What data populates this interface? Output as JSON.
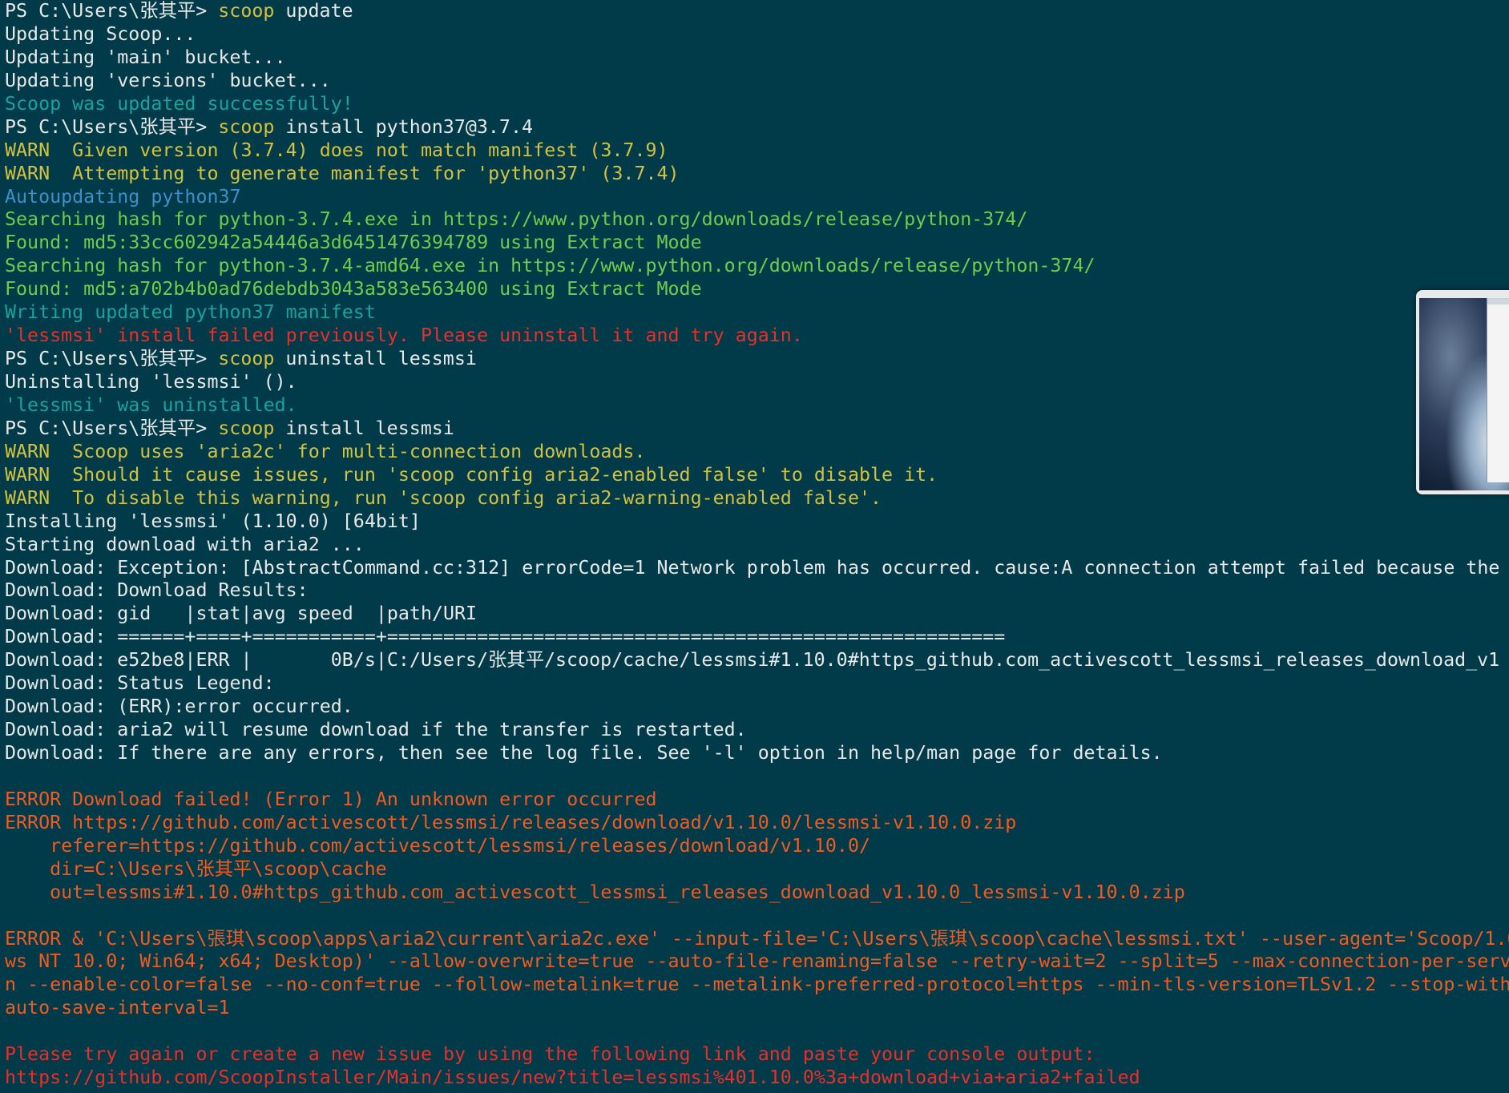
{
  "terminal": {
    "lines": [
      {
        "segments": [
          {
            "text": "PS C:\\Users\\张其平> ",
            "color": "white"
          },
          {
            "text": "scoop",
            "color": "yellow"
          },
          {
            "text": " update",
            "color": "white"
          }
        ]
      },
      {
        "segments": [
          {
            "text": "Updating Scoop...",
            "color": "white"
          }
        ]
      },
      {
        "segments": [
          {
            "text": "Updating 'main' bucket...",
            "color": "white"
          }
        ]
      },
      {
        "segments": [
          {
            "text": "Updating 'versions' bucket...",
            "color": "white"
          }
        ]
      },
      {
        "segments": [
          {
            "text": "Scoop was updated successfully!",
            "color": "cyan"
          }
        ]
      },
      {
        "segments": [
          {
            "text": "PS C:\\Users\\张其平> ",
            "color": "white"
          },
          {
            "text": "scoop",
            "color": "yellow"
          },
          {
            "text": " install python37@3.7.4",
            "color": "white"
          }
        ]
      },
      {
        "segments": [
          {
            "text": "WARN  Given version (3.7.4) does not match manifest (3.7.9)",
            "color": "yellow"
          }
        ]
      },
      {
        "segments": [
          {
            "text": "WARN  Attempting to generate manifest for 'python37' (3.7.4)",
            "color": "yellow"
          }
        ]
      },
      {
        "segments": [
          {
            "text": "Autoupdating python37",
            "color": "blue"
          }
        ]
      },
      {
        "segments": [
          {
            "text": "Searching hash for python-3.7.4.exe in https://www.python.org/downloads/release/python-374/",
            "color": "green"
          }
        ]
      },
      {
        "segments": [
          {
            "text": "Found: md5:33cc602942a54446a3d6451476394789 using Extract Mode",
            "color": "green"
          }
        ]
      },
      {
        "segments": [
          {
            "text": "Searching hash for python-3.7.4-amd64.exe in https://www.python.org/downloads/release/python-374/",
            "color": "green"
          }
        ]
      },
      {
        "segments": [
          {
            "text": "Found: md5:a702b4b0ad76debdb3043a583e563400 using Extract Mode",
            "color": "green"
          }
        ]
      },
      {
        "segments": [
          {
            "text": "Writing updated python37 manifest",
            "color": "cyan"
          }
        ]
      },
      {
        "segments": [
          {
            "text": "'lessmsi' install failed previously. Please uninstall it and try again.",
            "color": "red"
          }
        ]
      },
      {
        "segments": [
          {
            "text": "PS C:\\Users\\张其平> ",
            "color": "white"
          },
          {
            "text": "scoop",
            "color": "yellow"
          },
          {
            "text": " uninstall lessmsi",
            "color": "white"
          }
        ]
      },
      {
        "segments": [
          {
            "text": "Uninstalling 'lessmsi' ().",
            "color": "white"
          }
        ]
      },
      {
        "segments": [
          {
            "text": "'lessmsi' was uninstalled.",
            "color": "cyan"
          }
        ]
      },
      {
        "segments": [
          {
            "text": "PS C:\\Users\\张其平> ",
            "color": "white"
          },
          {
            "text": "scoop",
            "color": "yellow"
          },
          {
            "text": " install lessmsi",
            "color": "white"
          }
        ]
      },
      {
        "segments": [
          {
            "text": "WARN  Scoop uses 'aria2c' for multi-connection downloads.",
            "color": "yellow"
          }
        ]
      },
      {
        "segments": [
          {
            "text": "WARN  Should it cause issues, run 'scoop config aria2-enabled false' to disable it.",
            "color": "yellow"
          }
        ]
      },
      {
        "segments": [
          {
            "text": "WARN  To disable this warning, run 'scoop config aria2-warning-enabled false'.",
            "color": "yellow"
          }
        ]
      },
      {
        "segments": [
          {
            "text": "Installing 'lessmsi' (1.10.0) [64bit]",
            "color": "white"
          }
        ]
      },
      {
        "segments": [
          {
            "text": "Starting download with aria2 ...",
            "color": "white"
          }
        ]
      },
      {
        "segments": [
          {
            "text": "Download: Exception: [AbstractCommand.cc:312] errorCode=1 Network problem has occurred. cause:A connection attempt failed because the",
            "color": "white"
          }
        ]
      },
      {
        "segments": [
          {
            "text": "Download: Download Results:",
            "color": "white"
          }
        ]
      },
      {
        "segments": [
          {
            "text": "Download: gid   |stat|avg speed  |path/URI",
            "color": "white"
          }
        ]
      },
      {
        "segments": [
          {
            "text": "Download: ======+====+===========+=======================================================",
            "color": "white"
          }
        ]
      },
      {
        "segments": [
          {
            "text": "Download: e52be8|ERR |       0B/s|C:/Users/张其平/scoop/cache/lessmsi#1.10.0#https_github.com_activescott_lessmsi_releases_download_v1",
            "color": "white"
          }
        ]
      },
      {
        "segments": [
          {
            "text": "Download: Status Legend:",
            "color": "white"
          }
        ]
      },
      {
        "segments": [
          {
            "text": "Download: (ERR):error occurred.",
            "color": "white"
          }
        ]
      },
      {
        "segments": [
          {
            "text": "Download: aria2 will resume download if the transfer is restarted.",
            "color": "white"
          }
        ]
      },
      {
        "segments": [
          {
            "text": "Download: If there are any errors, then see the log file. See '-l' option in help/man page for details.",
            "color": "white"
          }
        ]
      },
      {
        "segments": [
          {
            "text": "",
            "color": "white"
          }
        ]
      },
      {
        "segments": [
          {
            "text": "ERROR Download failed! (Error 1) An unknown error occurred",
            "color": "orange"
          }
        ]
      },
      {
        "segments": [
          {
            "text": "ERROR https://github.com/activescott/lessmsi/releases/download/v1.10.0/lessmsi-v1.10.0.zip",
            "color": "orange"
          }
        ]
      },
      {
        "segments": [
          {
            "text": "    referer=https://github.com/activescott/lessmsi/releases/download/v1.10.0/",
            "color": "orange"
          }
        ]
      },
      {
        "segments": [
          {
            "text": "    dir=C:\\Users\\张其平\\scoop\\cache",
            "color": "orange"
          }
        ]
      },
      {
        "segments": [
          {
            "text": "    out=lessmsi#1.10.0#https_github.com_activescott_lessmsi_releases_download_v1.10.0_lessmsi-v1.10.0.zip",
            "color": "orange"
          }
        ]
      },
      {
        "segments": [
          {
            "text": "",
            "color": "white"
          }
        ]
      },
      {
        "segments": [
          {
            "text": "ERROR & 'C:\\Users\\張琪\\scoop\\apps\\aria2\\current\\aria2c.exe' --input-file='C:\\Users\\張琪\\scoop\\cache\\lessmsi.txt' --user-agent='Scoop/1.0",
            "color": "orange"
          }
        ]
      },
      {
        "segments": [
          {
            "text": "ws NT 10.0; Win64; x64; Desktop)' --allow-overwrite=true --auto-file-renaming=false --retry-wait=2 --split=5 --max-connection-per-serv",
            "color": "orange"
          }
        ]
      },
      {
        "segments": [
          {
            "text": "n --enable-color=false --no-conf=true --follow-metalink=true --metalink-preferred-protocol=https --min-tls-version=TLSv1.2 --stop-with",
            "color": "orange"
          }
        ]
      },
      {
        "segments": [
          {
            "text": "auto-save-interval=1",
            "color": "orange"
          }
        ]
      },
      {
        "segments": [
          {
            "text": "",
            "color": "white"
          }
        ]
      },
      {
        "segments": [
          {
            "text": "Please try again or create a new issue by using the following link and paste your console output:",
            "color": "red"
          }
        ]
      },
      {
        "segments": [
          {
            "text": "https://github.com/ScoopInstaller/Main/issues/new?title=lessmsi%401.10.0%3a+download+via+aria2+failed",
            "color": "red"
          }
        ]
      }
    ]
  },
  "thumbnail": {
    "icon": "desktop-preview-thumbnail"
  }
}
